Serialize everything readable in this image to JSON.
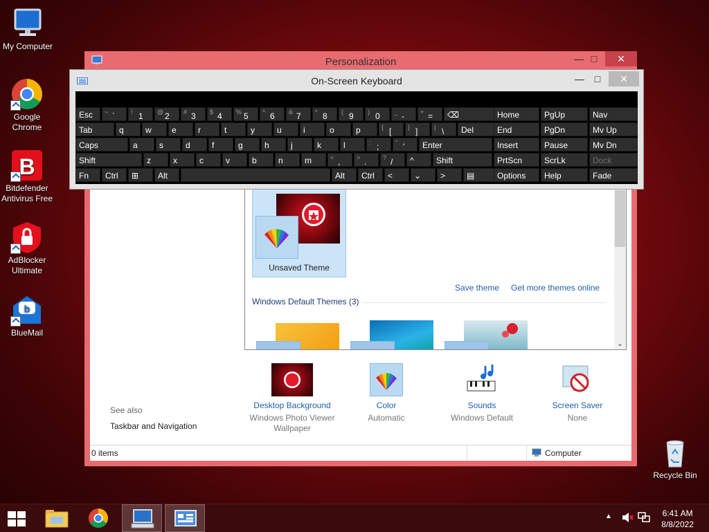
{
  "desktop": {
    "icons": [
      {
        "label": "My Computer"
      },
      {
        "label": "Google Chrome"
      },
      {
        "label": "Bitdefender Antivirus Free"
      },
      {
        "label": "AdBlocker Ultimate"
      },
      {
        "label": "BlueMail"
      },
      {
        "label": "Recycle Bin"
      }
    ]
  },
  "personalization": {
    "title": "Personalization",
    "theme_name": "Unsaved Theme",
    "save_theme": "Save theme",
    "get_more": "Get more themes online",
    "default_group": "Windows Default Themes (3)",
    "see_also": "See also",
    "taskbar_nav": "Taskbar and Navigation",
    "items": [
      {
        "label": "Desktop Background",
        "value": "Windows Photo Viewer Wallpaper"
      },
      {
        "label": "Color",
        "value": "Automatic"
      },
      {
        "label": "Sounds",
        "value": "Windows Default"
      },
      {
        "label": "Screen Saver",
        "value": "None"
      }
    ],
    "status_items": "0 items",
    "status_location": "Computer"
  },
  "osk": {
    "title": "On-Screen Keyboard",
    "rows": [
      [
        {
          "t": "Esc",
          "w": 36
        },
        {
          "s": "~",
          "t": "`",
          "w": 36
        },
        {
          "s": "!",
          "t": "1",
          "w": 36
        },
        {
          "s": "@",
          "t": "2",
          "w": 36
        },
        {
          "s": "#",
          "t": "3",
          "w": 36
        },
        {
          "s": "$",
          "t": "4",
          "w": 36
        },
        {
          "s": "%",
          "t": "5",
          "w": 36
        },
        {
          "s": "^",
          "t": "6",
          "w": 36
        },
        {
          "s": "&",
          "t": "7",
          "w": 36
        },
        {
          "s": "*",
          "t": "8",
          "w": 36
        },
        {
          "s": "(",
          "t": "9",
          "w": 36
        },
        {
          "s": ")",
          "t": "0",
          "w": 36
        },
        {
          "s": "_",
          "t": "-",
          "w": 36
        },
        {
          "s": "+",
          "t": "=",
          "w": 36
        },
        {
          "t": "⌫",
          "w": 74
        }
      ],
      [
        {
          "t": "Tab",
          "w": 56
        },
        {
          "t": "q",
          "w": 36
        },
        {
          "t": "w",
          "w": 36
        },
        {
          "t": "e",
          "w": 36
        },
        {
          "t": "r",
          "w": 36
        },
        {
          "t": "t",
          "w": 36
        },
        {
          "t": "y",
          "w": 36
        },
        {
          "t": "u",
          "w": 36
        },
        {
          "t": "i",
          "w": 36
        },
        {
          "t": "o",
          "w": 36
        },
        {
          "t": "p",
          "w": 36
        },
        {
          "s": "{",
          "t": "[",
          "w": 36
        },
        {
          "s": "}",
          "t": "]",
          "w": 36
        },
        {
          "s": "|",
          "t": "\\",
          "w": 36
        },
        {
          "t": "Del",
          "w": 54
        }
      ],
      [
        {
          "t": "Caps",
          "w": 76
        },
        {
          "t": "a",
          "w": 36
        },
        {
          "t": "s",
          "w": 36
        },
        {
          "t": "d",
          "w": 36
        },
        {
          "t": "f",
          "w": 36
        },
        {
          "t": "g",
          "w": 36
        },
        {
          "t": "h",
          "w": 36
        },
        {
          "t": "j",
          "w": 36
        },
        {
          "t": "k",
          "w": 36
        },
        {
          "t": "l",
          "w": 36
        },
        {
          "s": ":",
          "t": ";",
          "w": 36
        },
        {
          "s": "\"",
          "t": "'",
          "w": 36
        },
        {
          "t": "Enter",
          "w": 106
        }
      ],
      [
        {
          "t": "Shift",
          "w": 96
        },
        {
          "t": "z",
          "w": 36
        },
        {
          "t": "x",
          "w": 36
        },
        {
          "t": "c",
          "w": 36
        },
        {
          "t": "v",
          "w": 36
        },
        {
          "t": "b",
          "w": 36
        },
        {
          "t": "n",
          "w": 36
        },
        {
          "t": "m",
          "w": 36
        },
        {
          "s": "<",
          "t": ",",
          "w": 36
        },
        {
          "s": ">",
          "t": ".",
          "w": 36
        },
        {
          "s": "?",
          "t": "/",
          "w": 36
        },
        {
          "t": "^",
          "w": 36
        },
        {
          "t": "Shift",
          "w": 86
        }
      ],
      [
        {
          "t": "Fn",
          "w": 36
        },
        {
          "t": "Ctrl",
          "w": 36
        },
        {
          "t": "⊞",
          "w": 36
        },
        {
          "t": "Alt",
          "w": 36
        },
        {
          "t": "",
          "w": 216
        },
        {
          "t": "Alt",
          "w": 36
        },
        {
          "t": "Ctrl",
          "w": 36
        },
        {
          "t": "<",
          "w": 36
        },
        {
          "t": "⌄",
          "w": 36
        },
        {
          "t": ">",
          "w": 36
        },
        {
          "t": "▤",
          "w": 52
        }
      ]
    ],
    "nav_rows": [
      [
        "Home",
        "PgUp",
        "Nav"
      ],
      [
        "End",
        "PgDn",
        "Mv Up"
      ],
      [
        "Insert",
        "Pause",
        "Mv Dn"
      ],
      [
        "PrtScn",
        "ScrLk",
        "Dock"
      ],
      [
        "Options",
        "Help",
        "Fade"
      ]
    ]
  },
  "taskbar": {
    "time": "6:41 AM",
    "date": "8/8/2022"
  }
}
